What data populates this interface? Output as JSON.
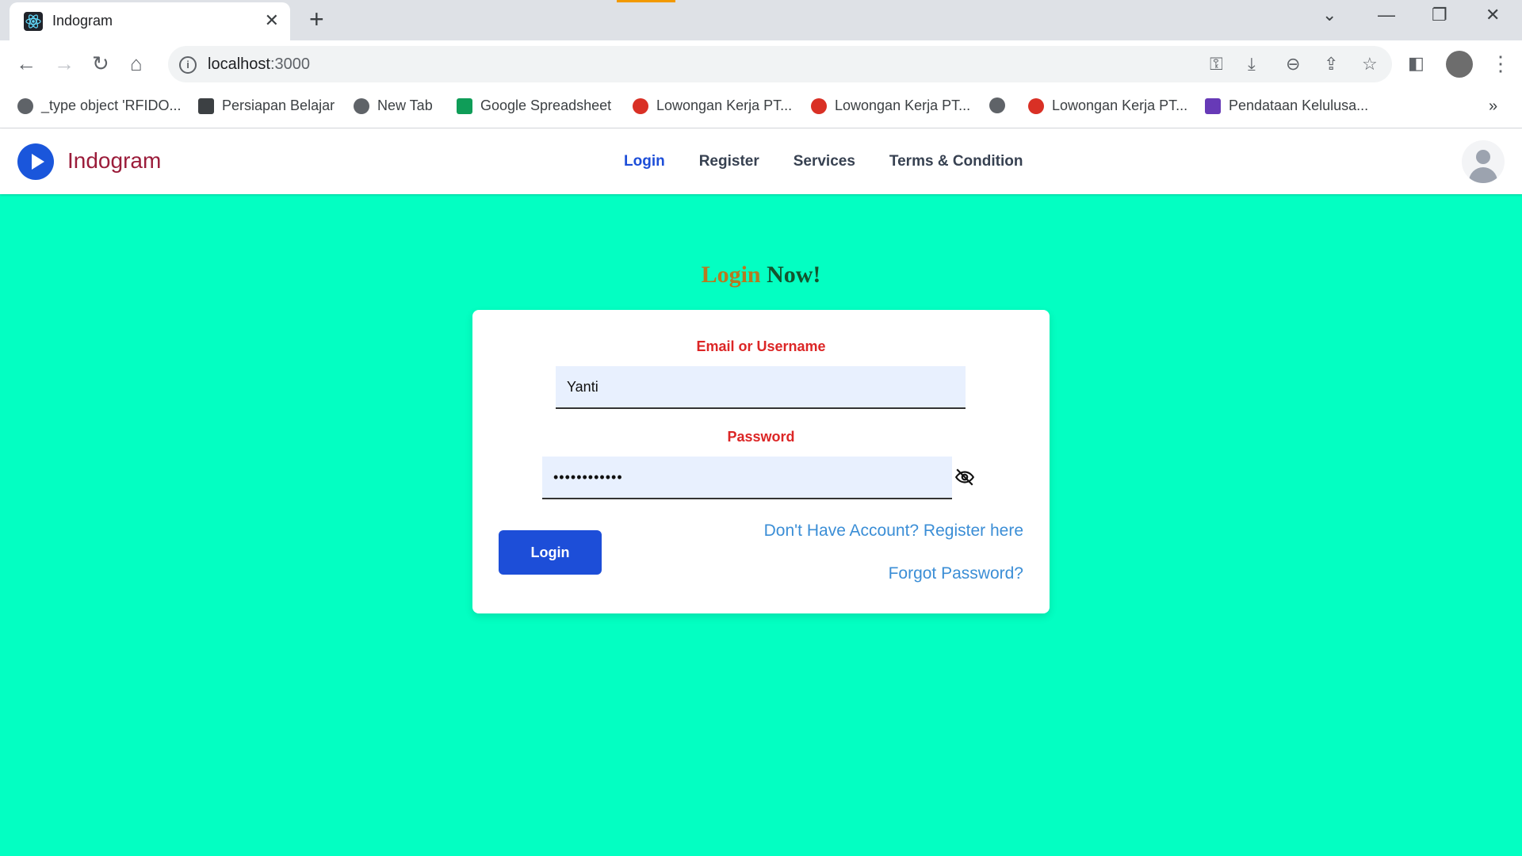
{
  "browser": {
    "tab_title": "Indogram",
    "url_host": "localhost",
    "url_port": ":3000",
    "bookmarks": [
      {
        "label": "_type object 'RFIDO...",
        "icon": "globe-icon",
        "color": "#5f6368"
      },
      {
        "label": "Persiapan Belajar",
        "icon": "g-icon",
        "color": "#3c4043"
      },
      {
        "label": "New Tab",
        "icon": "globe-icon",
        "color": "#5f6368"
      },
      {
        "label": "Google Spreadsheet",
        "icon": "sheets-icon",
        "color": "#0f9d58"
      },
      {
        "label": "Lowongan Kerja PT...",
        "icon": "job-icon",
        "color": "#d93025"
      },
      {
        "label": "Lowongan Kerja PT...",
        "icon": "job-icon",
        "color": "#d93025"
      },
      {
        "label": "",
        "icon": "globe-icon",
        "color": "#5f6368"
      },
      {
        "label": "Lowongan Kerja PT...",
        "icon": "job-icon",
        "color": "#d93025"
      },
      {
        "label": "Pendataan Kelulusa...",
        "icon": "forms-icon",
        "color": "#673ab7"
      }
    ],
    "more_bookmarks": "»"
  },
  "app": {
    "brand": "Indogram",
    "nav": {
      "login": "Login",
      "register": "Register",
      "services": "Services",
      "terms": "Terms & Condition"
    }
  },
  "login": {
    "heading_word1": "Login",
    "heading_word2": "Now!",
    "email_label": "Email or Username",
    "email_value": "Yanti",
    "password_label": "Password",
    "password_value": "••••••••••••",
    "login_button": "Login",
    "register_link": "Don't Have Account? Register here",
    "forgot_link": "Forgot Password?"
  },
  "colors": {
    "page_background": "#03ffc2",
    "primary": "#1d4ed8",
    "label_red": "#dc2626",
    "link_blue": "#3b8ed6"
  }
}
